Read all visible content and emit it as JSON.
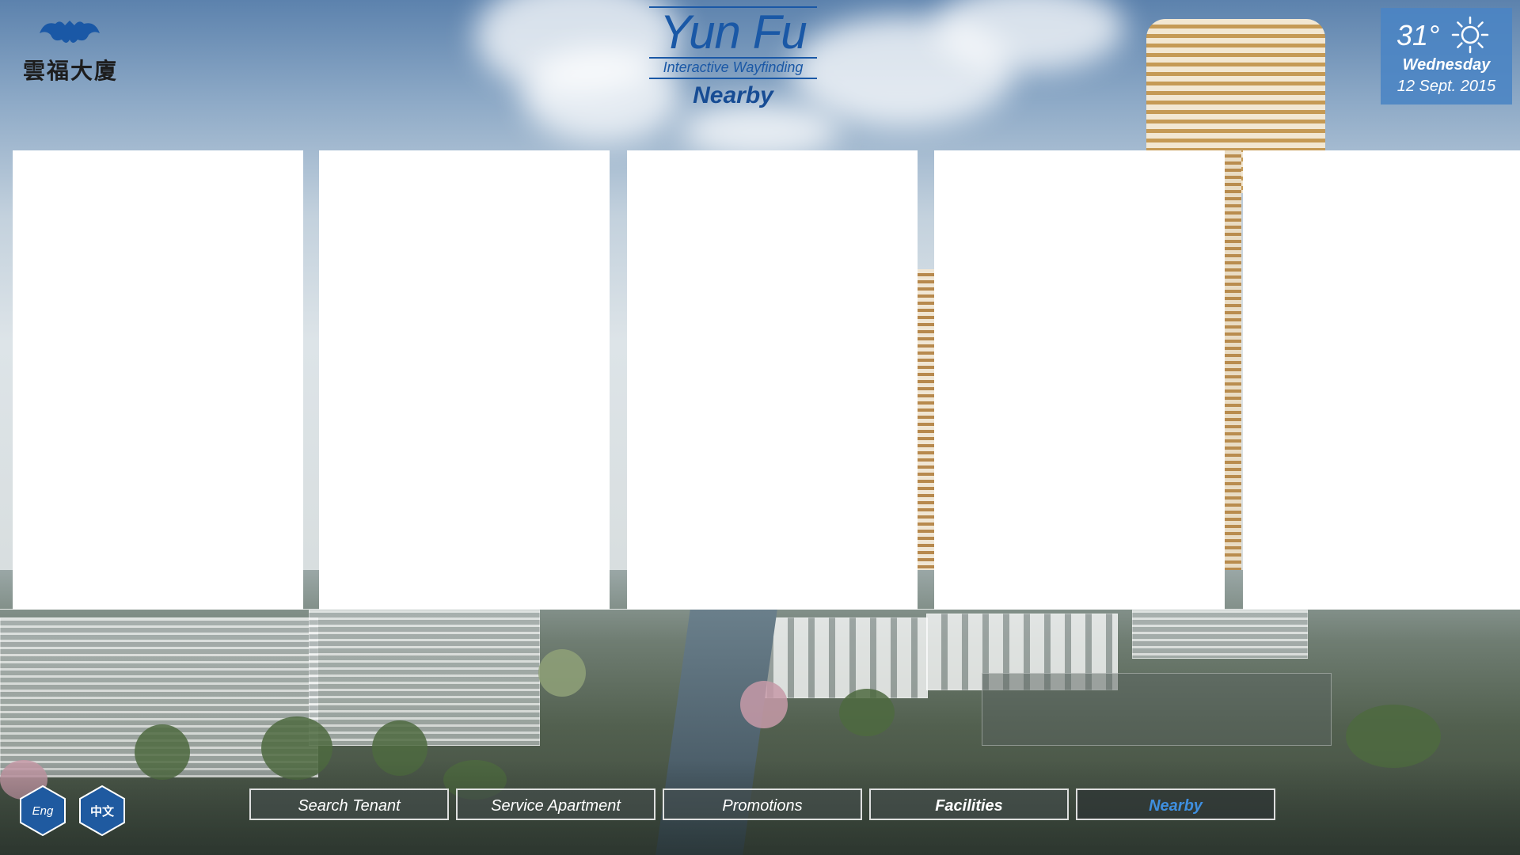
{
  "header": {
    "logo_text": "雲福大廈",
    "brand_title": "Yun Fu",
    "brand_subtitle": "Interactive Wayfinding",
    "page_title": "Nearby"
  },
  "weather": {
    "temperature": "31°",
    "icon": "sun-icon",
    "weekday": "Wednesday",
    "date": "12 Sept. 2015"
  },
  "panels": [
    {
      "id": "panel-1"
    },
    {
      "id": "panel-2"
    },
    {
      "id": "panel-3"
    },
    {
      "id": "panel-4"
    },
    {
      "id": "panel-5"
    }
  ],
  "language": {
    "english": "Eng",
    "chinese": "中文"
  },
  "nav": {
    "items": [
      {
        "label": "Search Tenant",
        "state": "normal"
      },
      {
        "label": "Service Apartment",
        "state": "normal"
      },
      {
        "label": "Promotions",
        "state": "normal"
      },
      {
        "label": "Facilities",
        "state": "bold"
      },
      {
        "label": "Nearby",
        "state": "active"
      }
    ]
  },
  "colors": {
    "brand_blue": "#1a58a6",
    "weather_bg": "#4a84c4",
    "active_nav": "#3f8fe0",
    "hex_blue": "#1f5aa0"
  }
}
